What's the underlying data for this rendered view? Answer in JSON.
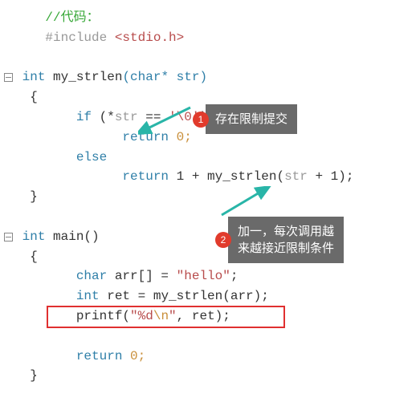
{
  "code": {
    "comment": "//代码：",
    "include_kw": "#include",
    "include_hdr": "<stdio.h>",
    "fn1_sig_type": "int",
    "fn1_sig_name": "my_strlen",
    "fn1_sig_param": "(char* str)",
    "fn1_open_brace": "{",
    "fn1_if_kw": "if",
    "fn1_if_cond_pre": " (*",
    "fn1_if_str": "str",
    "fn1_if_eq": " == ",
    "fn1_if_charlit": "'\\0'",
    "fn1_if_close": ")",
    "fn1_ret0_kw": "return",
    "fn1_ret0_val": " 0;",
    "fn1_else_kw": "else",
    "fn1_ret1_kw": "return",
    "fn1_ret1_expr_pre": " 1 + my_strlen(",
    "fn1_ret1_str": "str",
    "fn1_ret1_expr_post": " + 1);",
    "fn1_close_brace": "}",
    "main_type": "int",
    "main_name": " main()",
    "main_open_brace": "{",
    "arr_decl_type": "char",
    "arr_decl_name": " arr[] = ",
    "arr_decl_str": "\"hello\"",
    "arr_decl_semi": ";",
    "ret_decl_type": "int",
    "ret_decl_rest": " ret = my_strlen(arr);",
    "printf_name": "printf(",
    "printf_str_open": "\"",
    "printf_fmt": "%d",
    "printf_esc": "\\n",
    "printf_str_close": "\"",
    "printf_rest": ", ret);",
    "main_ret_kw": "return",
    "main_ret_val": " 0;",
    "main_close_brace": "}"
  },
  "callouts": {
    "c1_num": "1",
    "c1_text": "存在限制提交",
    "c2_num": "2",
    "c2_text": "加一，每次调用越\n来越接近限制条件"
  }
}
